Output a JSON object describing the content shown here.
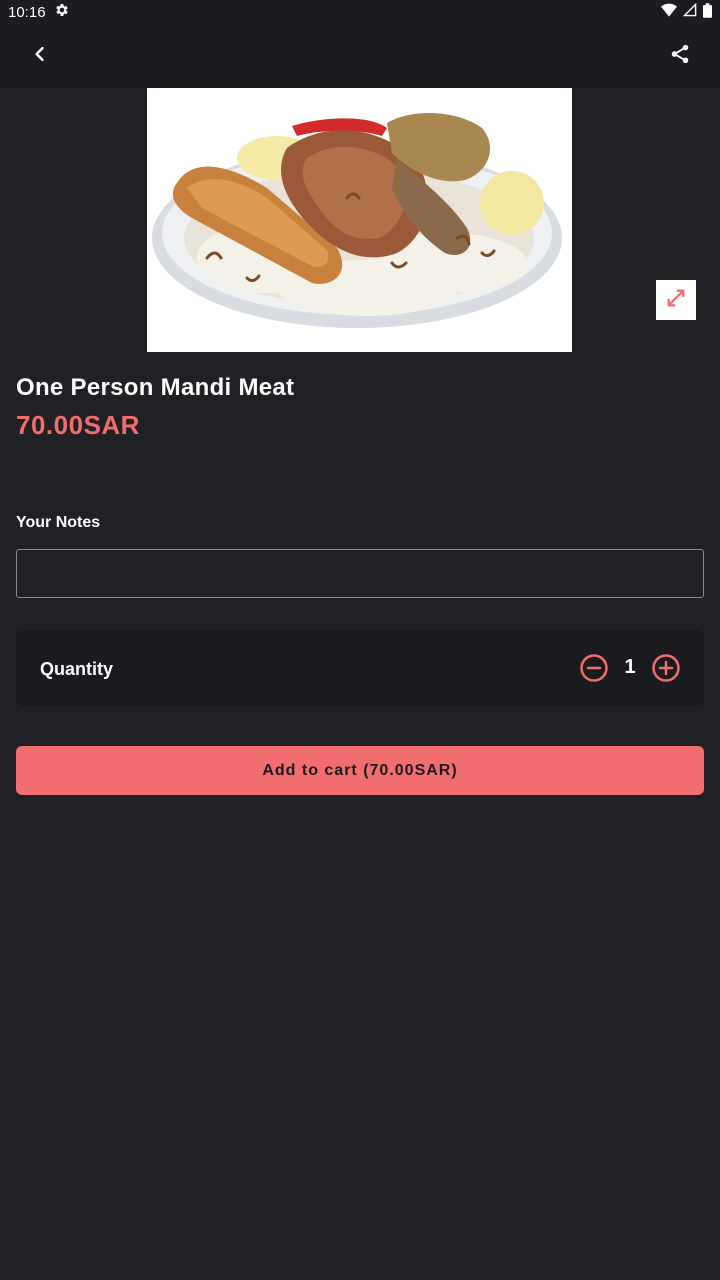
{
  "status_bar": {
    "time": "10:16",
    "icons": [
      "gear-icon",
      "wifi-icon",
      "signal-icon",
      "battery-icon"
    ]
  },
  "app_bar": {
    "back_icon": "chevron-left-icon",
    "share_icon": "share-icon"
  },
  "product": {
    "image": "plate of mandi rice with meat",
    "expand_icon": "expand-icon",
    "name": "One Person Mandi Meat",
    "price": "70.00SAR"
  },
  "notes": {
    "label": "Your Notes",
    "value": "",
    "placeholder": ""
  },
  "quantity": {
    "label": "Quantity",
    "value": "1",
    "minus_icon": "minus-circle-icon",
    "plus_icon": "plus-circle-icon"
  },
  "cart": {
    "button_label": "Add to cart (70.00SAR)"
  },
  "colors": {
    "background": "#202124",
    "bar": "#1b1c1f",
    "accent": "#f26d6d",
    "card": "#1a1b1e"
  }
}
